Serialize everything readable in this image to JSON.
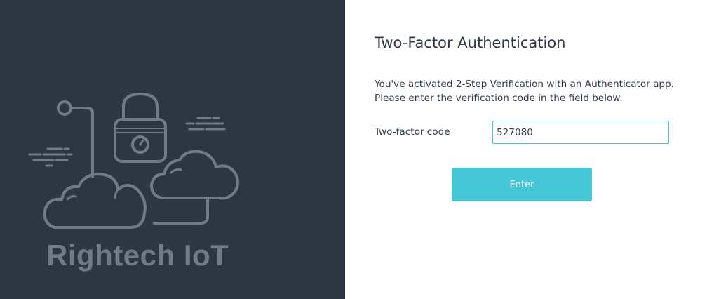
{
  "brand": {
    "name": "Rightech IoT"
  },
  "auth": {
    "title": "Two-Factor Authentication",
    "description_line1": "You've activated 2-Step Verification with an Authenticator app.",
    "description_line2": "Please enter the verification code in the field below.",
    "code_label": "Two-factor code",
    "code_value": "527080",
    "enter_label": "Enter"
  },
  "colors": {
    "left_panel_bg": "#2d3744",
    "illustration_stroke": "#6f7b87",
    "accent": "#45c6d7",
    "text": "#2f3945"
  },
  "illustration": {
    "icons": [
      "lock-icon",
      "cloud-icon",
      "circuit-line-icon",
      "speed-lines-icon"
    ]
  }
}
